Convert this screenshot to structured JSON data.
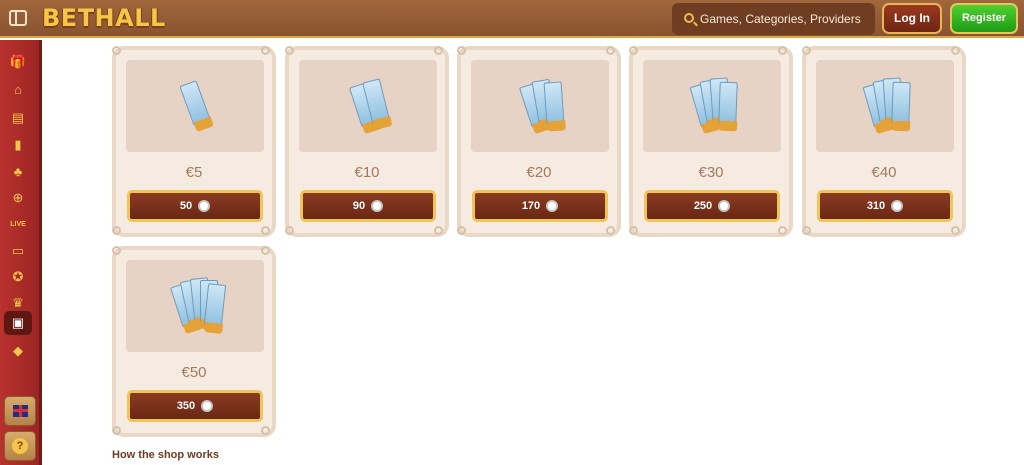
{
  "header": {
    "logo": "BETHALL",
    "search_placeholder": "Games, Categories, Providers",
    "login_label": "Log In",
    "register_label": "Register"
  },
  "sidebar": {
    "items": [
      {
        "icon": "gift-icon",
        "glyph": "🎁"
      },
      {
        "icon": "home-icon",
        "glyph": "⌂"
      },
      {
        "icon": "slot-machine-icon",
        "glyph": "▤"
      },
      {
        "icon": "cards-icon",
        "glyph": "▮"
      },
      {
        "icon": "clover-icon",
        "glyph": "♣"
      },
      {
        "icon": "sports-ball-icon",
        "glyph": "⊕"
      },
      {
        "icon": "live-icon",
        "glyph": "LIVE"
      },
      {
        "icon": "tv-icon",
        "glyph": "▭"
      },
      {
        "icon": "medal-icon",
        "glyph": "✪"
      },
      {
        "icon": "trophy-icon",
        "glyph": "♛"
      },
      {
        "icon": "shop-bag-icon",
        "glyph": "▣"
      },
      {
        "icon": "diamond-icon",
        "glyph": "◆"
      }
    ],
    "language": "English",
    "help_glyph": "?"
  },
  "shop": {
    "items": [
      {
        "price": "€5",
        "cost": "50",
        "tickets": 1
      },
      {
        "price": "€10",
        "cost": "90",
        "tickets": 2
      },
      {
        "price": "€20",
        "cost": "170",
        "tickets": 3
      },
      {
        "price": "€30",
        "cost": "250",
        "tickets": 4
      },
      {
        "price": "€40",
        "cost": "310",
        "tickets": 4
      },
      {
        "price": "€50",
        "cost": "350",
        "tickets": 5
      }
    ],
    "how_it_works_title": "How the shop works"
  }
}
